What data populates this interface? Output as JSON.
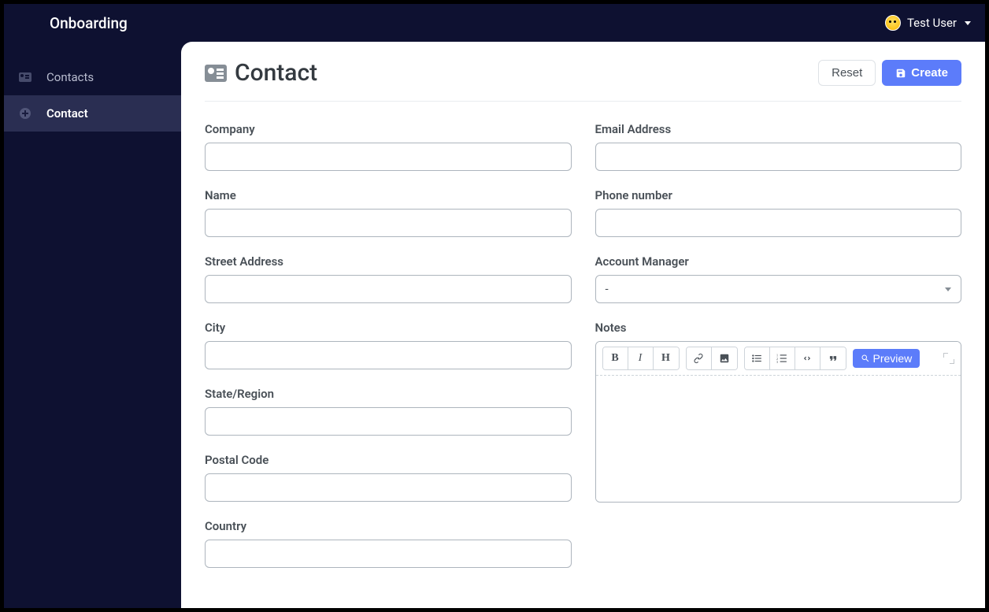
{
  "header": {
    "brand": "Onboarding",
    "user_name": "Test User"
  },
  "sidebar": {
    "items": [
      {
        "label": "Contacts",
        "icon": "contacts-card-icon",
        "active": false
      },
      {
        "label": "Contact",
        "icon": "plus-circle-icon",
        "active": true
      }
    ]
  },
  "page": {
    "title": "Contact",
    "actions": {
      "reset_label": "Reset",
      "create_label": "Create"
    }
  },
  "form": {
    "left": [
      {
        "key": "company",
        "label": "Company",
        "value": ""
      },
      {
        "key": "name",
        "label": "Name",
        "value": ""
      },
      {
        "key": "street",
        "label": "Street Address",
        "value": ""
      },
      {
        "key": "city",
        "label": "City",
        "value": ""
      },
      {
        "key": "state",
        "label": "State/Region",
        "value": ""
      },
      {
        "key": "postal",
        "label": "Postal Code",
        "value": ""
      },
      {
        "key": "country",
        "label": "Country",
        "value": ""
      }
    ],
    "right_email": {
      "label": "Email Address",
      "value": ""
    },
    "right_phone": {
      "label": "Phone number",
      "value": ""
    },
    "account_manager": {
      "label": "Account Manager",
      "selected": "-"
    },
    "notes": {
      "label": "Notes",
      "preview_label": "Preview"
    }
  }
}
